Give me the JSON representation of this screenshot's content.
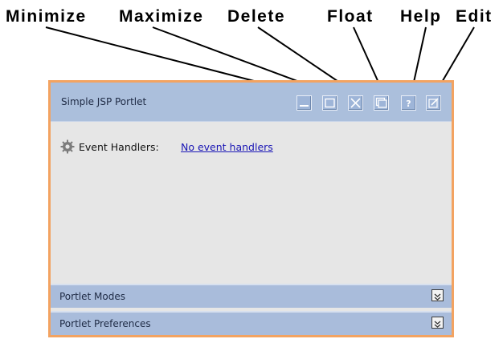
{
  "callouts": {
    "minimize": "Minimize",
    "maximize": "Maximize",
    "delete": "Delete",
    "float": "Float",
    "help": "Help",
    "edit": "Edit"
  },
  "portlet": {
    "title": "Simple JSP Portlet",
    "buttons": [
      {
        "name": "minimize",
        "icon": "minimize-icon"
      },
      {
        "name": "maximize",
        "icon": "maximize-icon"
      },
      {
        "name": "delete",
        "icon": "close-icon"
      },
      {
        "name": "float",
        "icon": "float-icon"
      },
      {
        "name": "help",
        "icon": "question-icon"
      },
      {
        "name": "edit",
        "icon": "edit-icon"
      }
    ],
    "event_handlers_label": "Event Handlers:",
    "event_handlers_link": "No event handlers",
    "sections": [
      "Portlet Modes",
      "Portlet Preferences"
    ]
  },
  "colors": {
    "frame_border": "#f3a361",
    "title_bar": "#abbfdc",
    "content_bg": "#e6e6e6",
    "link": "#1a16b5"
  }
}
